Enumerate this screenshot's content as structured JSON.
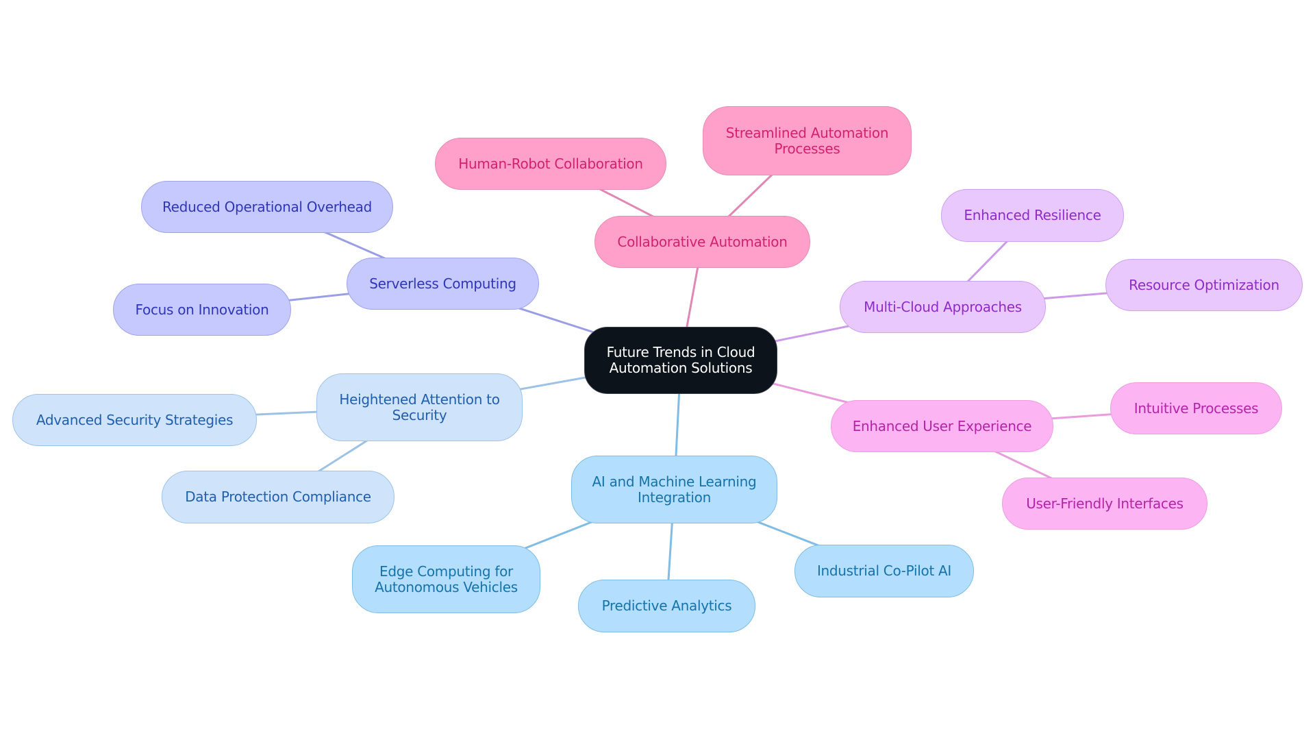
{
  "diagram": {
    "type": "mindmap",
    "root": {
      "id": "root",
      "label": "Future Trends in Cloud\nAutomation Solutions"
    },
    "branches": [
      {
        "id": "collab",
        "label": "Collaborative Automation",
        "theme": "pink",
        "edge_color": "#e187b4",
        "children": [
          {
            "id": "hrc",
            "label": "Human-Robot Collaboration"
          },
          {
            "id": "sap",
            "label": "Streamlined Automation\nProcesses"
          }
        ]
      },
      {
        "id": "serverless",
        "label": "Serverless Computing",
        "theme": "indigo",
        "edge_color": "#9a9ee6",
        "children": [
          {
            "id": "roo",
            "label": "Reduced Operational Overhead"
          },
          {
            "id": "foi",
            "label": "Focus on Innovation"
          }
        ]
      },
      {
        "id": "multicloud",
        "label": "Multi-Cloud Approaches",
        "theme": "violet",
        "edge_color": "#cc9ae9",
        "children": [
          {
            "id": "er",
            "label": "Enhanced Resilience"
          },
          {
            "id": "ro",
            "label": "Resource Optimization"
          }
        ]
      },
      {
        "id": "ux",
        "label": "Enhanced User Experience",
        "theme": "magenta",
        "edge_color": "#ea9bdb",
        "children": [
          {
            "id": "ip",
            "label": "Intuitive Processes"
          },
          {
            "id": "ufi",
            "label": "User-Friendly Interfaces"
          }
        ]
      },
      {
        "id": "security",
        "label": "Heightened Attention to\nSecurity",
        "theme": "sky",
        "edge_color": "#9ec2e6",
        "children": [
          {
            "id": "ass",
            "label": "Advanced Security Strategies"
          },
          {
            "id": "dpc",
            "label": "Data Protection Compliance"
          }
        ]
      },
      {
        "id": "aiml",
        "label": "AI and Machine Learning\nIntegration",
        "theme": "blue",
        "edge_color": "#7fbde4",
        "children": [
          {
            "id": "ecav",
            "label": "Edge Computing for\nAutonomous Vehicles"
          },
          {
            "id": "pa",
            "label": "Predictive Analytics"
          },
          {
            "id": "icp",
            "label": "Industrial Co-Pilot AI"
          }
        ]
      }
    ]
  }
}
